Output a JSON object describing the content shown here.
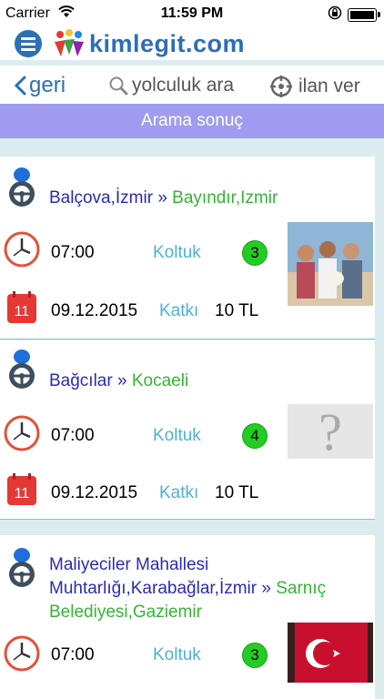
{
  "status_bar": {
    "carrier": "Carrier",
    "time": "11:59 PM"
  },
  "app": {
    "logo_text": "kimlegit.com",
    "brand_color": "#2d6fb5"
  },
  "nav": {
    "back_label": "geri",
    "search_label": "yolculuk ara",
    "post_label": "ilan ver"
  },
  "results_header": "Arama sonuç",
  "results": [
    {
      "origin": "Balçova,İzmir",
      "separator": "»",
      "destination": "Bayındır,Izmir",
      "time": "07:00",
      "seat_label": "Koltuk",
      "seats": "3",
      "date": "09.12.2015",
      "fee_label": "Katkı",
      "fee": "10 TL",
      "calendar_day": "11",
      "photo": "group-photo"
    },
    {
      "origin": "Bağcılar",
      "separator": "»",
      "destination": "Kocaeli",
      "time": "07:00",
      "seat_label": "Koltuk",
      "seats": "4",
      "date": "09.12.2015",
      "fee_label": "Katkı",
      "fee": "10 TL",
      "calendar_day": "11",
      "photo": "unknown"
    },
    {
      "origin": "Maliyeciler Mahallesi Muhtarlığı,Karabağlar,İzmir",
      "separator": "»",
      "destination": "Sarnıç Belediyesi,Gaziemir",
      "time": "07:00",
      "seat_label": "Koltuk",
      "seats": "3",
      "photo": "flag-photo"
    }
  ]
}
